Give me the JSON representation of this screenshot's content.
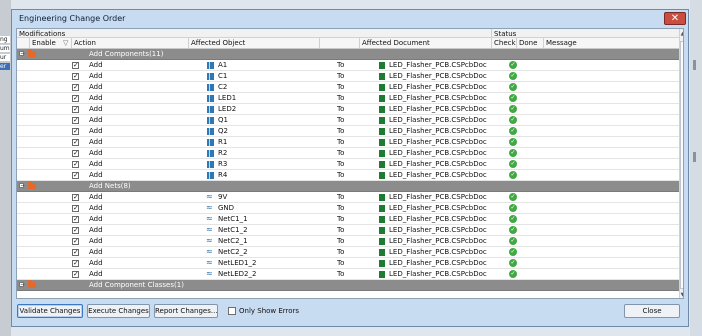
{
  "window_title": "Engineering Change Order",
  "close_glyph": "✕",
  "group_headers": {
    "modifications": "Modifications",
    "status": "Status"
  },
  "columns": {
    "enable": "Enable",
    "action": "Action",
    "affected_object": "Affected Object",
    "affected_document": "Affected Document",
    "check": "Check",
    "done": "Done",
    "message": "Message"
  },
  "background_fragments": [
    "ng",
    "um",
    "ur",
    "er"
  ],
  "rows": [
    {
      "type": "group",
      "label": "Add Components(11)"
    },
    {
      "type": "item",
      "enabled": true,
      "action": "Add",
      "icon": "component-icon",
      "object": "A1",
      "to": "To",
      "document": "LED_Flasher_PCB.CSPcbDoc",
      "check": "ok"
    },
    {
      "type": "item",
      "enabled": true,
      "action": "Add",
      "icon": "component-icon",
      "object": "C1",
      "to": "To",
      "document": "LED_Flasher_PCB.CSPcbDoc",
      "check": "ok"
    },
    {
      "type": "item",
      "enabled": true,
      "action": "Add",
      "icon": "component-icon",
      "object": "C2",
      "to": "To",
      "document": "LED_Flasher_PCB.CSPcbDoc",
      "check": "ok"
    },
    {
      "type": "item",
      "enabled": true,
      "action": "Add",
      "icon": "component-icon",
      "object": "LED1",
      "to": "To",
      "document": "LED_Flasher_PCB.CSPcbDoc",
      "check": "ok"
    },
    {
      "type": "item",
      "enabled": true,
      "action": "Add",
      "icon": "component-icon",
      "object": "LED2",
      "to": "To",
      "document": "LED_Flasher_PCB.CSPcbDoc",
      "check": "ok"
    },
    {
      "type": "item",
      "enabled": true,
      "action": "Add",
      "icon": "component-icon",
      "object": "Q1",
      "to": "To",
      "document": "LED_Flasher_PCB.CSPcbDoc",
      "check": "ok"
    },
    {
      "type": "item",
      "enabled": true,
      "action": "Add",
      "icon": "component-icon",
      "object": "Q2",
      "to": "To",
      "document": "LED_Flasher_PCB.CSPcbDoc",
      "check": "ok"
    },
    {
      "type": "item",
      "enabled": true,
      "action": "Add",
      "icon": "component-icon",
      "object": "R1",
      "to": "To",
      "document": "LED_Flasher_PCB.CSPcbDoc",
      "check": "ok"
    },
    {
      "type": "item",
      "enabled": true,
      "action": "Add",
      "icon": "component-icon",
      "object": "R2",
      "to": "To",
      "document": "LED_Flasher_PCB.CSPcbDoc",
      "check": "ok"
    },
    {
      "type": "item",
      "enabled": true,
      "action": "Add",
      "icon": "component-icon",
      "object": "R3",
      "to": "To",
      "document": "LED_Flasher_PCB.CSPcbDoc",
      "check": "ok"
    },
    {
      "type": "item",
      "enabled": true,
      "action": "Add",
      "icon": "component-icon",
      "object": "R4",
      "to": "To",
      "document": "LED_Flasher_PCB.CSPcbDoc",
      "check": "ok"
    },
    {
      "type": "group",
      "label": "Add Nets(8)"
    },
    {
      "type": "item",
      "enabled": true,
      "action": "Add",
      "icon": "net-icon",
      "object": "9V",
      "to": "To",
      "document": "LED_Flasher_PCB.CSPcbDoc",
      "check": "ok"
    },
    {
      "type": "item",
      "enabled": true,
      "action": "Add",
      "icon": "net-icon",
      "object": "GND",
      "to": "To",
      "document": "LED_Flasher_PCB.CSPcbDoc",
      "check": "ok"
    },
    {
      "type": "item",
      "enabled": true,
      "action": "Add",
      "icon": "net-icon",
      "object": "NetC1_1",
      "to": "To",
      "document": "LED_Flasher_PCB.CSPcbDoc",
      "check": "ok"
    },
    {
      "type": "item",
      "enabled": true,
      "action": "Add",
      "icon": "net-icon",
      "object": "NetC1_2",
      "to": "To",
      "document": "LED_Flasher_PCB.CSPcbDoc",
      "check": "ok"
    },
    {
      "type": "item",
      "enabled": true,
      "action": "Add",
      "icon": "net-icon",
      "object": "NetC2_1",
      "to": "To",
      "document": "LED_Flasher_PCB.CSPcbDoc",
      "check": "ok"
    },
    {
      "type": "item",
      "enabled": true,
      "action": "Add",
      "icon": "net-icon",
      "object": "NetC2_2",
      "to": "To",
      "document": "LED_Flasher_PCB.CSPcbDoc",
      "check": "ok"
    },
    {
      "type": "item",
      "enabled": true,
      "action": "Add",
      "icon": "net-icon",
      "object": "NetLED1_2",
      "to": "To",
      "document": "LED_Flasher_PCB.CSPcbDoc",
      "check": "ok"
    },
    {
      "type": "item",
      "enabled": true,
      "action": "Add",
      "icon": "net-icon",
      "object": "NetLED2_2",
      "to": "To",
      "document": "LED_Flasher_PCB.CSPcbDoc",
      "check": "ok"
    },
    {
      "type": "group",
      "label": "Add Component Classes(1)"
    }
  ],
  "buttons": {
    "validate": "Validate Changes",
    "execute": "Execute Changes",
    "report": "Report Changes...",
    "only_show_errors": "Only Show Errors",
    "close": "Close"
  },
  "colors": {
    "group_row": "#8c8c8c",
    "check_ok": "#42a844",
    "component_icon": "#2f78b8",
    "doc_icon": "#1e7b31",
    "folder_icon": "#e46a2a"
  }
}
